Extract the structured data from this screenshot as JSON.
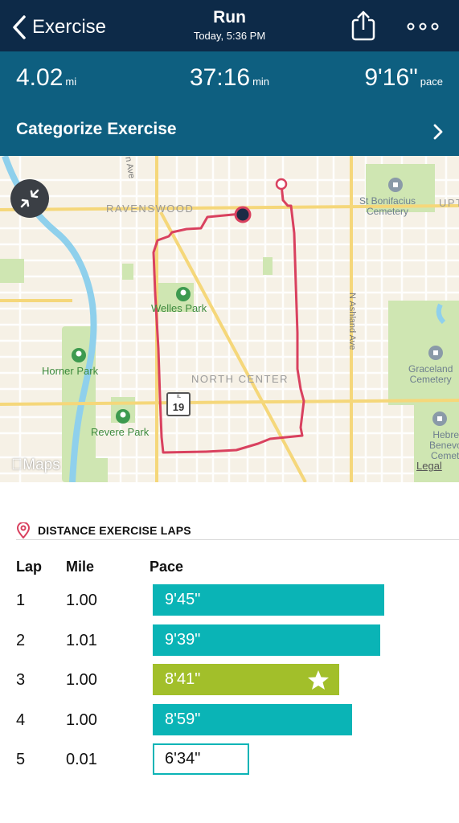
{
  "nav": {
    "back_label": "Exercise",
    "title": "Run",
    "subtitle": "Today, 5:36 PM",
    "share_icon": "share-icon",
    "more_icon": "more-dots-icon"
  },
  "stats": {
    "distance": "4.02",
    "distance_unit": "mi",
    "duration": "37:16",
    "duration_unit": "min",
    "pace": "9'16\"",
    "pace_unit": "pace"
  },
  "categorize": {
    "label": "Categorize Exercise"
  },
  "map": {
    "labels": {
      "ravenswood": "RAVENSWOOD",
      "ave_fragment": "n Ave",
      "st_bonifacius": "St Bonifacius\nCemetery",
      "upt": "UPT",
      "welles_park": "Welles Park",
      "ashland": "N Ashland Ave",
      "horner_park": "Horner Park",
      "north_center": "NORTH CENTER",
      "graceland": "Graceland\nCemetery",
      "revere_park": "Revere Park",
      "hebrew": "Hebrew\nBenevole\nCemeter",
      "route_shield": "19",
      "route_state": "IL"
    },
    "logo": "Maps",
    "legal": "Legal",
    "colors": {
      "route": "#d9415f",
      "land": "#f6f1e6",
      "park": "#cfe6b2",
      "water": "#8fd0ec",
      "major_road": "#f5d77a"
    }
  },
  "laps": {
    "section_title": "DISTANCE EXERCISE LAPS",
    "columns": {
      "lap": "Lap",
      "mile": "Mile",
      "pace": "Pace"
    },
    "rows": [
      {
        "lap": "1",
        "mile": "1.00",
        "pace": "9'45\"",
        "pace_seconds": 585,
        "style": "fill"
      },
      {
        "lap": "2",
        "mile": "1.01",
        "pace": "9'39\"",
        "pace_seconds": 579,
        "style": "fill"
      },
      {
        "lap": "3",
        "mile": "1.00",
        "pace": "8'41\"",
        "pace_seconds": 521,
        "style": "best",
        "badge": "star-icon"
      },
      {
        "lap": "4",
        "mile": "1.00",
        "pace": "8'59\"",
        "pace_seconds": 539,
        "style": "fill"
      },
      {
        "lap": "5",
        "mile": "0.01",
        "pace": "6'34\"",
        "pace_seconds": 394,
        "style": "empty"
      }
    ],
    "colors": {
      "fill": "#0ab4b6",
      "best": "#a2bf2a"
    }
  }
}
